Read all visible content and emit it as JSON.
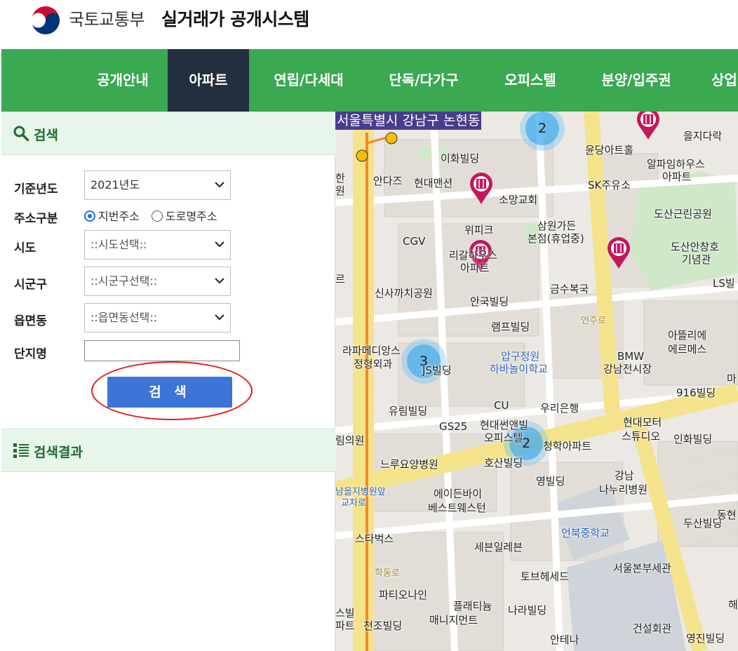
{
  "header": {
    "ministry": "국토교통부",
    "title": "실거래가 공개시스템"
  },
  "nav": {
    "items": [
      "공개안내",
      "아파트",
      "연립/다세대",
      "단독/다가구",
      "오피스텔",
      "분양/입주권",
      "상업"
    ],
    "active": "아파트"
  },
  "search": {
    "section_title": "검색",
    "labels": {
      "year": "기준년도",
      "addr_type": "주소구분",
      "sido": "시도",
      "sigungu": "시군구",
      "dong": "읍면동",
      "complex": "단지명"
    },
    "year_value": "2021년도",
    "radio_jibun": "지번주소",
    "radio_road": "도로명주소",
    "sido_value": "::시도선택::",
    "sigungu_value": "::시군구선택::",
    "dong_value": "::읍면동선택::",
    "complex_value": "",
    "button": "검 색"
  },
  "results": {
    "section_title": "검색결과"
  },
  "map": {
    "location_label": "서울특별시 강남구 논현동",
    "clusters": [
      "2",
      "3",
      "2"
    ],
    "labels": [
      "이화빌딩",
      "안다즈",
      "현대맨션",
      "소망교회",
      "윤당아트홀",
      "SK주유소",
      "을지다락",
      "알파임하우스",
      "아파트",
      "도산근린공원",
      "도산안창호",
      "기념관",
      "위피크",
      "CGV",
      "삼원가든",
      "본점(휴업중)",
      "리갈하우스",
      "아파트",
      "신사까치공원",
      "안국빌딩",
      "금수복국",
      "LS빌",
      "램프빌딩",
      "아뜰리에",
      "에르메스",
      "라파메디앙스",
      "정형외과",
      "JS빌딩",
      "압구정원",
      "하바놀이학교",
      "BMW",
      "강남전시장",
      "916빌딩",
      "유림빌딩",
      "CU",
      "우리은행",
      "GS25",
      "현대썬앤빌",
      "오피스텔",
      "청학아파트",
      "현대모터",
      "스튜디오",
      "인화빌딩",
      "림의원",
      "느루요양병원",
      "호산빌딩",
      "강남",
      "나누리병원",
      "영빌딩",
      "에이든바이",
      "베스트웨스턴",
      "남을지병원앞",
      "교차로",
      "스타벅스",
      "세븐일레븐",
      "언북중학교",
      "두산빌딩",
      "동현",
      "토브헤세드",
      "서울본부세관",
      "파티오나인",
      "플래티늄",
      "매니지먼트",
      "나라빌딩",
      "천조빌딩",
      "건설회관",
      "영진빌딩",
      "안테나",
      "한",
      "원",
      "르",
      "마",
      "스빌",
      "파트",
      "해"
    ],
    "road_labels": [
      "언주로",
      "학동로"
    ]
  },
  "colors": {
    "nav_green": "#3aa952",
    "nav_active": "#232f3e",
    "button_blue": "#3d74d8",
    "highlight_red": "#e0201c",
    "marker_pink": "#c2185b",
    "cluster_blue": "#3caaf0"
  }
}
